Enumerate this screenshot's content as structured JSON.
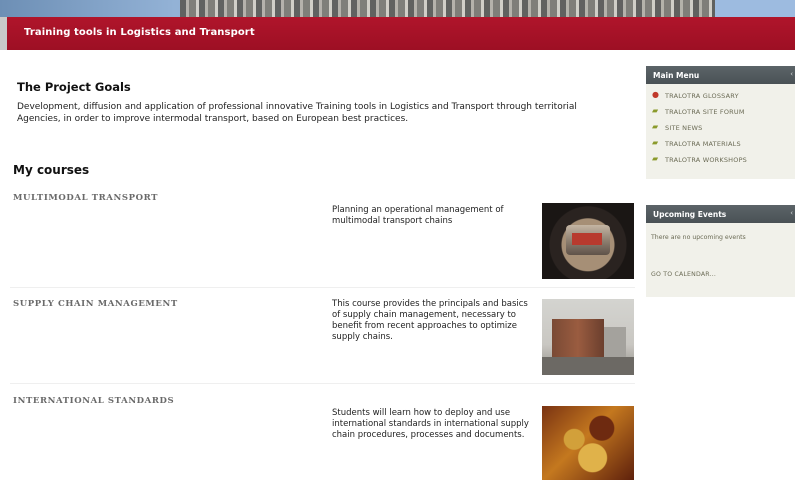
{
  "site": {
    "title": "Training tools in Logistics and Transport"
  },
  "intro": {
    "heading": "The Project Goals",
    "text": "Development, diffusion and application of professional innovative Training tools in Logistics and Transport through territorial Agencies, in order to improve intermodal transport, based on European best practices."
  },
  "courses": {
    "heading": "My courses",
    "items": [
      {
        "name": "MULTIMODAL TRANSPORT",
        "description": "Planning an operational management of multimodal transport chains"
      },
      {
        "name": "SUPPLY CHAIN MANAGEMENT",
        "description": "This course provides the principals and basics of supply chain management, necessary to benefit from recent approaches to optimize supply chains."
      },
      {
        "name": "INTERNATIONAL STANDARDS",
        "description": "Students will learn how to deploy and use international standards in international supply chain procedures, processes and documents."
      }
    ]
  },
  "main_menu": {
    "title": "Main Menu",
    "toggle": "‹",
    "items": [
      {
        "label": "TRALOTRA GLOSSARY",
        "icon": "globe-icon"
      },
      {
        "label": "TRALOTRA SITE FORUM",
        "icon": "forum-icon"
      },
      {
        "label": "SITE NEWS",
        "icon": "forum-icon"
      },
      {
        "label": "TRALOTRA MATERIALS",
        "icon": "forum-icon"
      },
      {
        "label": "TRALOTRA WORKSHOPS",
        "icon": "forum-icon"
      }
    ]
  },
  "upcoming_events": {
    "title": "Upcoming Events",
    "toggle": "‹",
    "empty_text": "There are no upcoming events",
    "calendar_link": "GO TO CALENDAR..."
  }
}
